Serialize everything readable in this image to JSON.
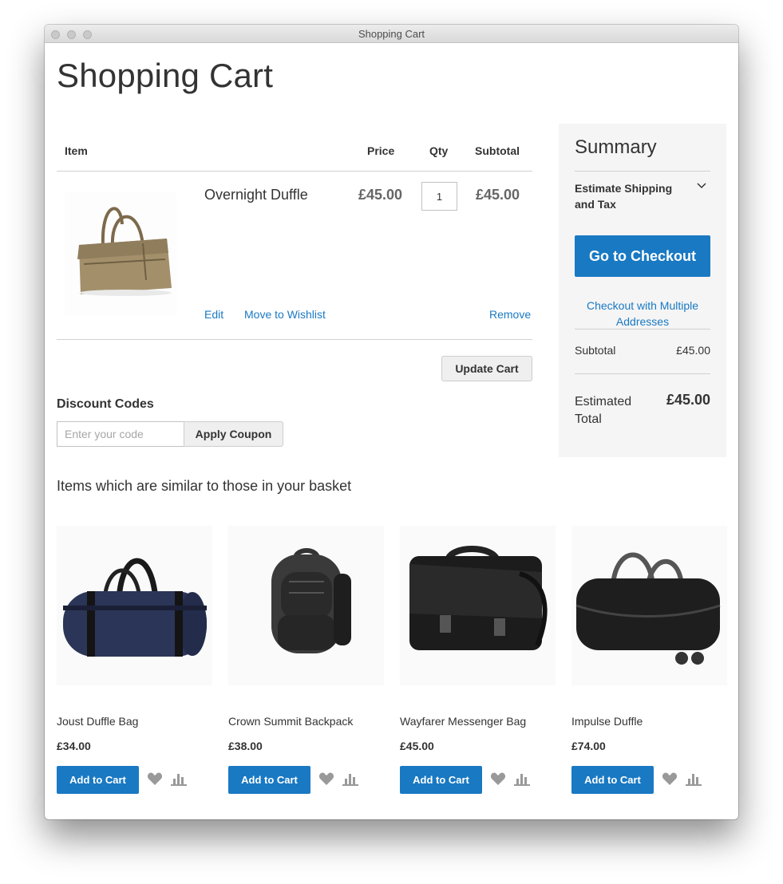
{
  "window": {
    "title": "Shopping Cart"
  },
  "page_title": "Shopping Cart",
  "cart": {
    "columns": {
      "item": "Item",
      "price": "Price",
      "qty": "Qty",
      "subtotal": "Subtotal"
    },
    "item": {
      "name": "Overnight Duffle",
      "price": "£45.00",
      "qty": "1",
      "subtotal": "£45.00",
      "edit": "Edit",
      "wishlist": "Move to Wishlist",
      "remove": "Remove"
    },
    "update_button": "Update Cart"
  },
  "discount": {
    "title": "Discount Codes",
    "placeholder": "Enter your code",
    "apply_button": "Apply Coupon"
  },
  "summary": {
    "title": "Summary",
    "estimate_line1": "Estimate Shipping",
    "estimate_line2": "and Tax",
    "checkout_button": "Go to Checkout",
    "multi_line1": "Checkout with Multiple",
    "multi_line2": "Addresses",
    "subtotal_label": "Subtotal",
    "subtotal_value": "£45.00",
    "total_label_line1": "Estimated",
    "total_label_line2": "Total",
    "total_value": "£45.00"
  },
  "similar": {
    "title": "Items which are similar to those in your basket",
    "products": [
      {
        "name": "Joust Duffle Bag",
        "price": "£34.00",
        "button": "Add to Cart"
      },
      {
        "name": "Crown Summit Backpack",
        "price": "£38.00",
        "button": "Add to Cart"
      },
      {
        "name": "Wayfarer Messenger Bag",
        "price": "£45.00",
        "button": "Add to Cart"
      },
      {
        "name": "Impulse Duffle",
        "price": "£74.00",
        "button": "Add to Cart"
      }
    ]
  },
  "colors": {
    "accent": "#1979c3",
    "summary_bg": "#f5f5f5"
  },
  "icons": [
    "heart-icon",
    "compare-icon",
    "chevron-down-icon"
  ]
}
